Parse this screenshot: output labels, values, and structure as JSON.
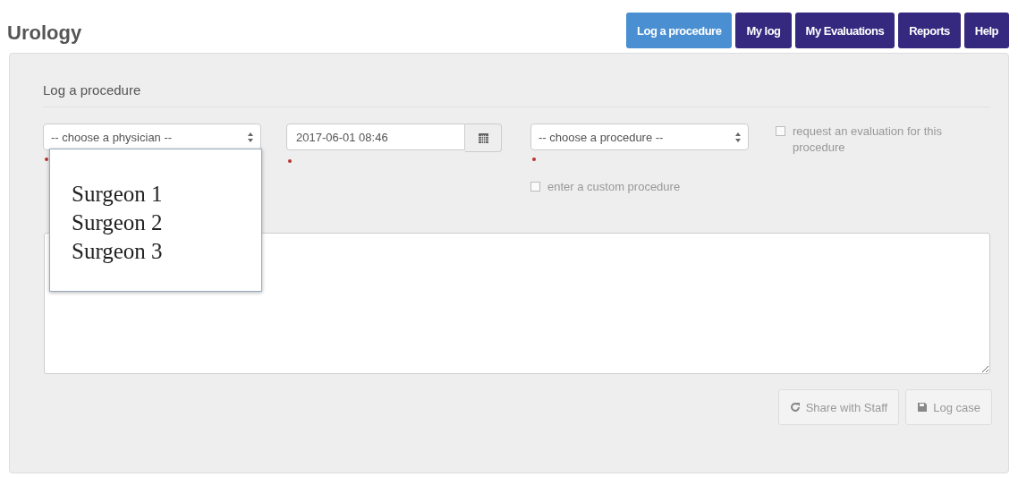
{
  "header": {
    "title": "Urology"
  },
  "tabs": [
    {
      "label": "Log a procedure",
      "selected": true
    },
    {
      "label": "My log",
      "selected": false
    },
    {
      "label": "My Evaluations",
      "selected": false
    },
    {
      "label": "Reports",
      "selected": false
    },
    {
      "label": "Help",
      "selected": false
    }
  ],
  "form": {
    "heading": "Log a procedure",
    "physician": {
      "placeholder": "-- choose a physician --",
      "required": true,
      "expanded": true,
      "options": [
        "Surgeon 1",
        "Surgeon 2",
        "Surgeon 3"
      ]
    },
    "date": {
      "value": "2017-06-01 08:46",
      "required": true
    },
    "procedure": {
      "placeholder": "-- choose a procedure --",
      "required": true
    },
    "checkboxes": [
      {
        "label": "request an evaluation for this procedure",
        "checked": false
      },
      {
        "label": "enter a custom procedure",
        "checked": false
      }
    ],
    "buttons": [
      {
        "kind": "share",
        "label": "Share with Staff"
      },
      {
        "kind": "log",
        "label": "Log case"
      }
    ]
  }
}
